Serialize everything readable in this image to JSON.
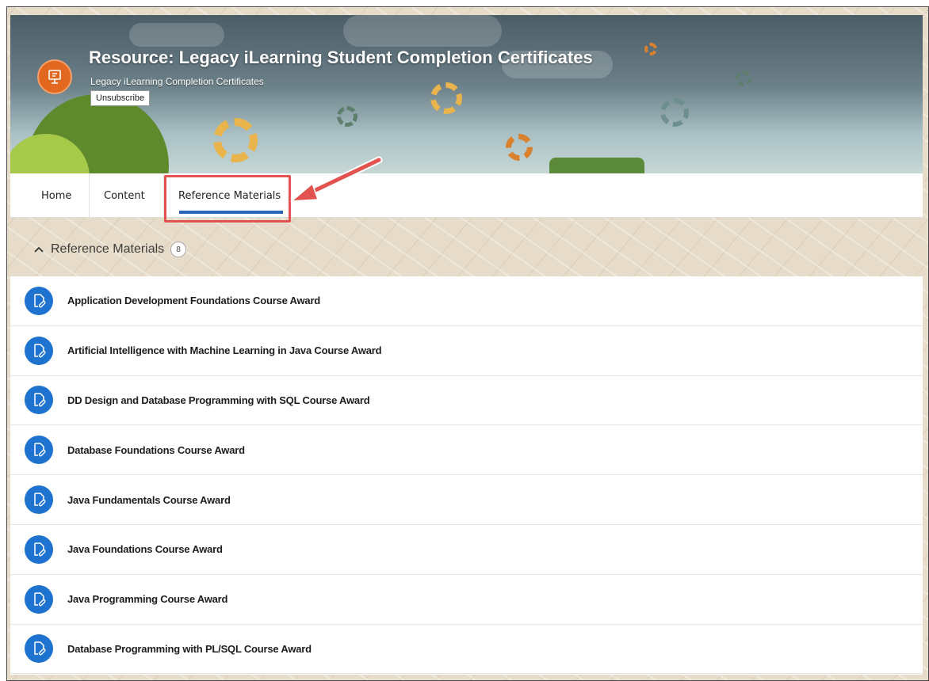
{
  "header": {
    "title": "Resource: Legacy iLearning Student Completion Certificates",
    "subtitle": "Legacy iLearning Completion Certificates",
    "unsubscribe_label": "Unsubscribe",
    "logo_icon": "presentation-board-icon"
  },
  "tabs": [
    {
      "label": "Home"
    },
    {
      "label": "Content"
    },
    {
      "label": "Reference Materials",
      "active": true
    }
  ],
  "section": {
    "label": "Reference Materials",
    "count": "8",
    "chevron_icon": "chevron-up-icon"
  },
  "items": [
    {
      "title": "Application Development Foundations Course Award"
    },
    {
      "title": "Artificial Intelligence with Machine Learning in Java Course Award"
    },
    {
      "title": "DD Design and Database Programming with SQL Course Award"
    },
    {
      "title": "Database Foundations Course Award"
    },
    {
      "title": "Java Fundamentals Course Award"
    },
    {
      "title": "Java Foundations Course Award"
    },
    {
      "title": "Java Programming Course Award"
    },
    {
      "title": "Database Programming with PL/SQL Course Award"
    }
  ],
  "colors": {
    "accent_blue": "#1e73d0",
    "tab_underline": "#2a66b8",
    "callout_red": "#e2534f",
    "logo_orange": "#e2681f"
  }
}
